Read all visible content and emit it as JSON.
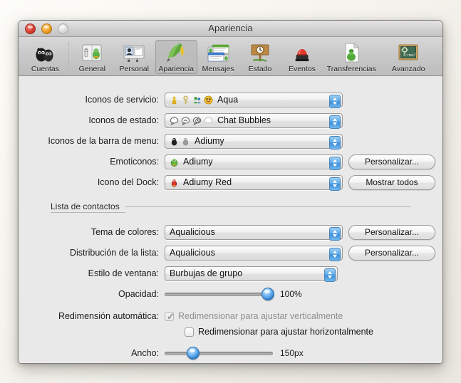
{
  "window": {
    "title": "Apariencia",
    "traffic_lights": [
      {
        "name": "close-button",
        "color": "#dd4436"
      },
      {
        "name": "minimize-button",
        "color": "#f2a32c"
      },
      {
        "name": "zoom-button",
        "color": "#dcdcdc"
      }
    ]
  },
  "toolbar": {
    "items": [
      {
        "label": "Cuentas",
        "icon": "accounts-icon",
        "selected": false
      },
      {
        "label": "General",
        "icon": "general-icon",
        "selected": false
      },
      {
        "label": "Personal",
        "icon": "personal-icon",
        "selected": false
      },
      {
        "label": "Apariencia",
        "icon": "appearance-feather-icon",
        "selected": true
      },
      {
        "label": "Mensajes",
        "icon": "messages-icon",
        "selected": false
      },
      {
        "label": "Estado",
        "icon": "status-signpost-icon",
        "selected": false
      },
      {
        "label": "Eventos",
        "icon": "events-siren-icon",
        "selected": false
      },
      {
        "label": "Transferencias",
        "icon": "transfers-icon",
        "selected": false
      },
      {
        "label": "Avanzado",
        "icon": "advanced-chalkboard-icon",
        "selected": false
      }
    ]
  },
  "form": {
    "service_icons": {
      "label": "Iconos de servicio:",
      "value": "Aqua"
    },
    "status_icons": {
      "label": "Iconos de estado:",
      "value": "Chat Bubbles"
    },
    "menubar_icons": {
      "label": "Iconos de la barra de menu:",
      "value": "Adiumy"
    },
    "emoticons": {
      "label": "Emoticonos:",
      "value": "Adiumy",
      "button": "Personalizar..."
    },
    "dock_icon": {
      "label": "Icono del Dock:",
      "value": "Adiumy Red",
      "button": "Mostrar todos"
    }
  },
  "contact_list": {
    "section_title": "Lista de contactos",
    "color_theme": {
      "label": "Tema de colores:",
      "value": "Aqualicious",
      "button": "Personalizar..."
    },
    "layout": {
      "label": "Distribución de la lista:",
      "value": "Aqualicious",
      "button": "Personalizar..."
    },
    "window_style": {
      "label": "Estilo de ventana:",
      "value": "Burbujas de grupo"
    },
    "opacity": {
      "label": "Opacidad:",
      "value": "100%",
      "percent": 100
    },
    "auto_resize": {
      "label": "Redimensión automática:",
      "vertical": {
        "text": "Redimensionar para ajustar verticalmente",
        "checked": true,
        "enabled": false
      },
      "horizontal": {
        "text": "Redimensionar para ajustar horizontalmente",
        "checked": false,
        "enabled": true
      }
    },
    "width": {
      "label": "Ancho:",
      "value": "150px",
      "percent": 23
    }
  }
}
